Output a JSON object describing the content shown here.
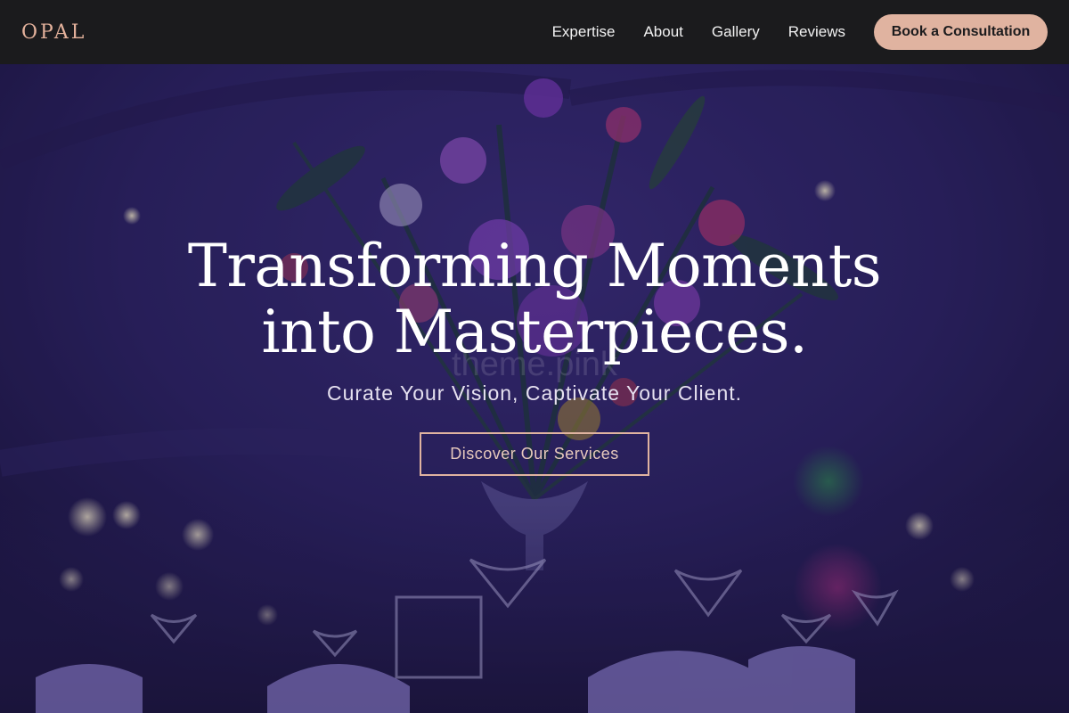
{
  "navbar": {
    "logo": "OPAL",
    "links": [
      "Expertise",
      "About",
      "Gallery",
      "Reviews"
    ],
    "cta_label": "Book a Consultation"
  },
  "hero": {
    "title_line1": "Transforming Moments",
    "title_line2": "into Masterpieces.",
    "subtitle": "Curate Your Vision, Captivate Your Client.",
    "button_label": "Discover Our Services",
    "watermark": "theme.pink",
    "background_image": "purple-lit-event-venue-with-flower-centerpiece-and-glassware"
  },
  "colors": {
    "navbar_bg": "#1b1b1d",
    "accent": "#e0b3a0",
    "hero_tint": "#2a2152"
  }
}
